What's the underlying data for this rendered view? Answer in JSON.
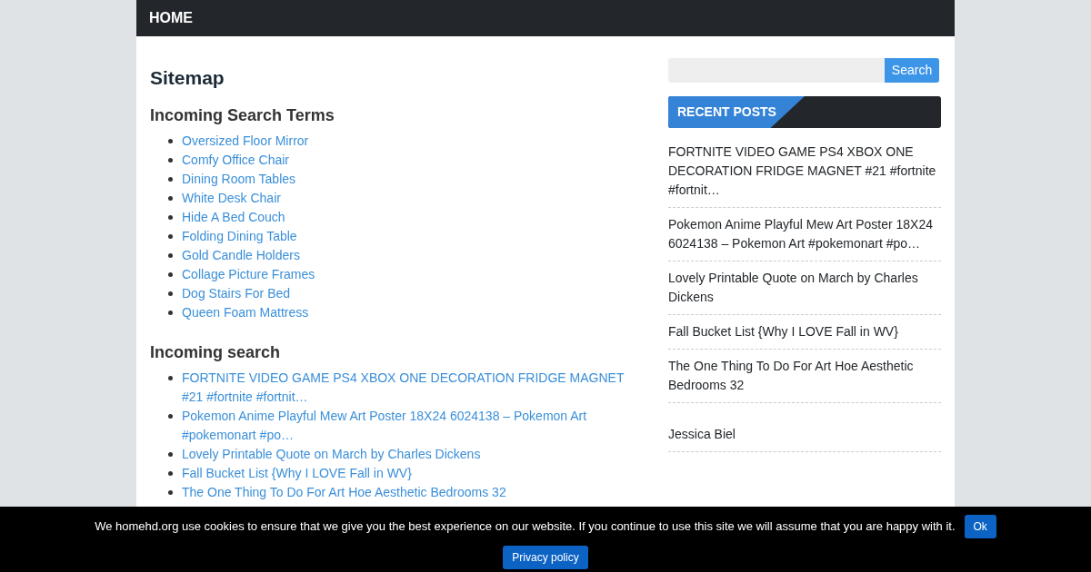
{
  "nav": {
    "items": [
      {
        "label": "HOME"
      }
    ]
  },
  "page_title": "Sitemap",
  "sections": [
    {
      "heading": "Incoming Search Terms",
      "links": [
        "Oversized Floor Mirror",
        "Comfy Office Chair",
        "Dining Room Tables",
        "White Desk Chair",
        "Hide A Bed Couch",
        "Folding Dining Table",
        "Gold Candle Holders",
        "Collage Picture Frames",
        "Dog Stairs For Bed",
        "Queen Foam Mattress"
      ]
    },
    {
      "heading": "Incoming search",
      "links": [
        "FORTNITE VIDEO GAME PS4 XBOX ONE DECORATION FRIDGE MAGNET #21 #fortnite #fortnit…",
        "Pokemon Anime Playful Mew Art Poster 18X24 6024138 – Pokemon Art #pokemonart #po…",
        "Lovely Printable Quote on March by Charles Dickens",
        "Fall Bucket List {Why I LOVE Fall in WV}",
        "The One Thing To Do For Art Hoe Aesthetic Bedrooms 32"
      ]
    }
  ],
  "sidebar": {
    "search_button": "Search",
    "widget_title": "RECENT POSTS",
    "posts": [
      "FORTNITE VIDEO GAME PS4 XBOX ONE DECORATION FRIDGE MAGNET #21 #fortnite #fortnit…",
      "Pokemon Anime Playful Mew Art Poster 18X24 6024138 – Pokemon Art #pokemonart #po…",
      "Lovely Printable Quote on March by Charles Dickens",
      "Fall Bucket List {Why I LOVE Fall in WV}",
      "The One Thing To Do For Art Hoe Aesthetic Bedrooms 32"
    ],
    "extra_posts": [
      "Jessica Biel"
    ]
  },
  "cookie_bar": {
    "message": "We homehd.org use cookies to ensure that we give you the best experience on our website. If you continue to use this site we will assume that you are happy with it.",
    "ok_button": "Ok",
    "privacy_button": "Privacy policy"
  }
}
